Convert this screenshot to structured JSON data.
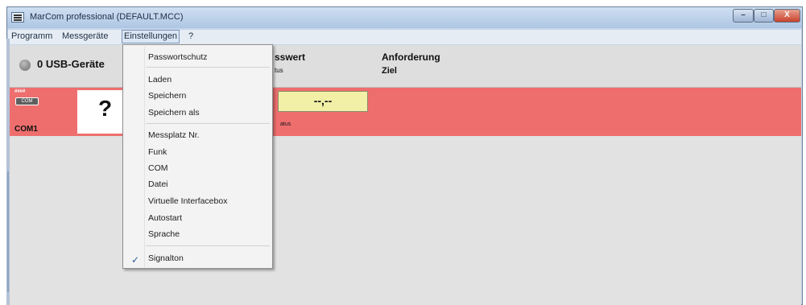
{
  "window": {
    "title": "MarCom professional   (DEFAULT.MCC)",
    "controls": {
      "minimize": "–",
      "maximize": "□",
      "close": "X"
    }
  },
  "menubar": {
    "items": [
      "Programm",
      "Messgeräte",
      "Einstellungen",
      "?"
    ]
  },
  "header": {
    "usb_count": "0",
    "usb_label": "USB-Geräte",
    "col_messwert": "sswert",
    "col_messwert_sub": "tus",
    "col_anforderung": "Anforderung",
    "col_ziel": "Ziel"
  },
  "device": {
    "type_label": "####",
    "interface_label": "COM",
    "port": "COM1",
    "unknown_symbol": "?",
    "value": "--,--",
    "status": "atus"
  },
  "dropdown": {
    "items": [
      "Passwortschutz",
      "Laden",
      "Speichern",
      "Speichern als",
      "Messplatz Nr.",
      "Funk",
      "COM",
      "Datei",
      "Virtuelle Interfacebox",
      "Autostart",
      "Sprache",
      "Signalton"
    ],
    "checked": "Signalton",
    "checkmark": "✓"
  },
  "colors": {
    "device_row": "#ee6e6e",
    "value_box": "#f2f0a6",
    "titlebar": "#aec6e3"
  }
}
